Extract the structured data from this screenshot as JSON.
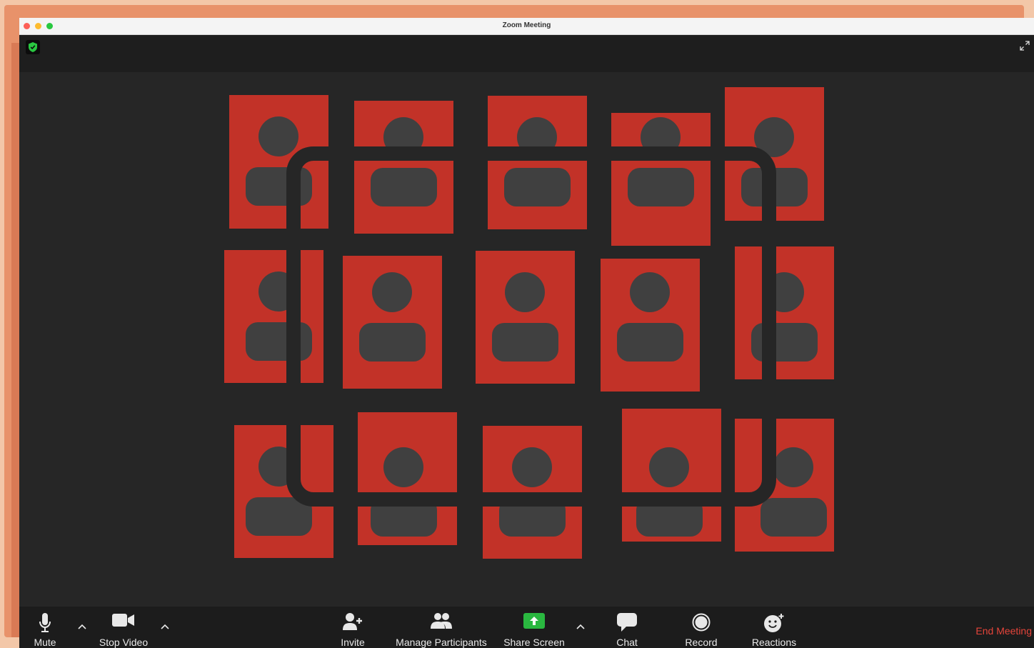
{
  "window": {
    "title": "Zoom Meeting"
  },
  "gallery": {
    "participant_count": 15
  },
  "toolbar": {
    "mute_label": "Mute",
    "stop_video_label": "Stop Video",
    "invite_label": "Invite",
    "manage_participants_label": "Manage Participants",
    "share_screen_label": "Share Screen",
    "chat_label": "Chat",
    "record_label": "Record",
    "reactions_label": "Reactions",
    "end_meeting_label": "End Meeting"
  },
  "colors": {
    "tile": "#c23228",
    "avatar": "#404040",
    "share_accent": "#2ab840",
    "end_meeting": "#e5443a",
    "encryption_shield": "#29c741"
  }
}
